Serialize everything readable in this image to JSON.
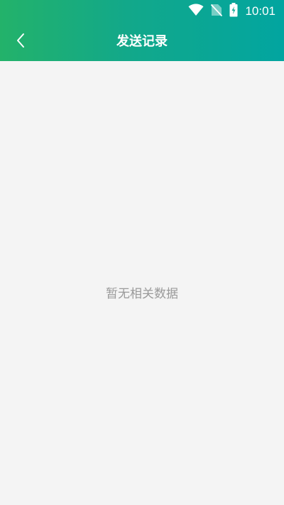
{
  "status_bar": {
    "time": "10:01",
    "icons": [
      "wifi-icon",
      "no-sim-icon",
      "battery-charging-icon"
    ]
  },
  "header": {
    "title": "发送记录",
    "back_icon": "chevron-left-icon",
    "gradient_start": "#23b26a",
    "gradient_end": "#02a5a0"
  },
  "content": {
    "empty_message": "暂无相关数据",
    "background": "#f4f4f4"
  }
}
